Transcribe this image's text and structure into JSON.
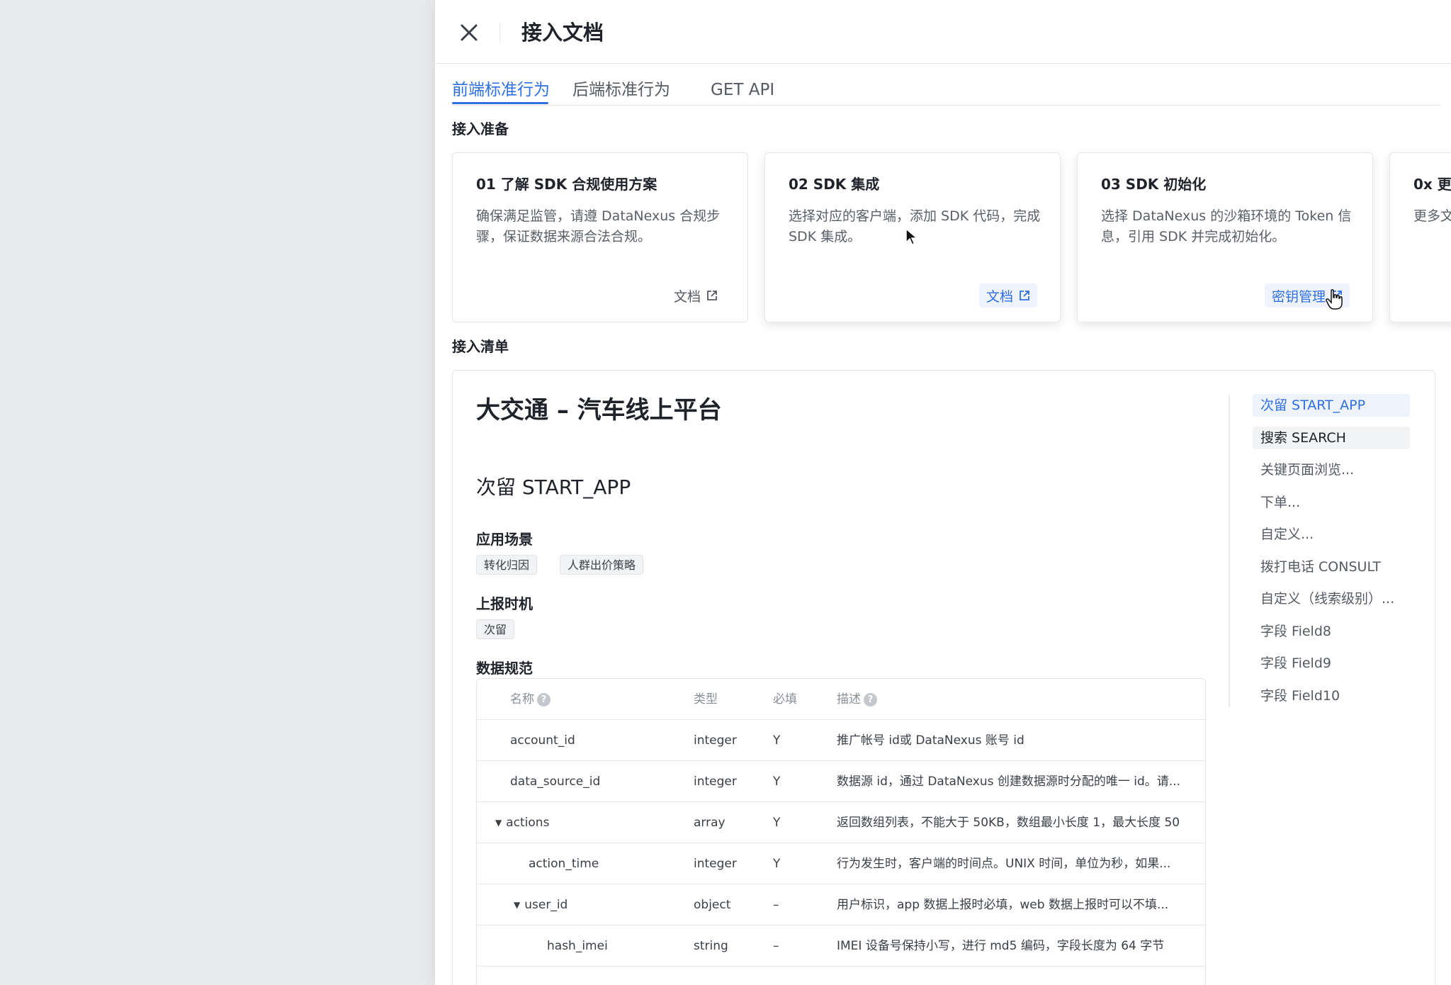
{
  "header": {
    "title": "接入文档",
    "close_icon": "close-icon"
  },
  "tabs": [
    {
      "label": "前端标准行为",
      "active": true
    },
    {
      "label": "后端标准行为",
      "active": false
    },
    {
      "label": "GET API",
      "active": false
    }
  ],
  "prep": {
    "title": "接入准备",
    "cards": [
      {
        "title": "01 了解 SDK 合规使用方案",
        "desc": "确保满足监管，请遵 DataNexus 合规步骤，保证数据来源合法合规。",
        "action": "文档"
      },
      {
        "title": "02 SDK 集成",
        "desc": "选择对应的客户端，添加 SDK 代码，完成 SDK 集成。",
        "action": "文档"
      },
      {
        "title": "03 SDK 初始化",
        "desc": "选择 DataNexus 的沙箱环境的 Token 信息，引用 SDK 并完成初始化。",
        "action": "密钥管理"
      },
      {
        "title": "0x 更",
        "desc": "更多文",
        "action": ""
      }
    ]
  },
  "list": {
    "title": "接入清单",
    "doc_title": "大交通 – 汽车线上平台",
    "event_title": "次留 START_APP",
    "scene_label": "应用场景",
    "scene_tags": [
      "转化归因",
      "人群出价策略"
    ],
    "timing_label": "上报时机",
    "timing_tags": [
      "次留"
    ],
    "spec_label": "数据规范",
    "table": {
      "headers": {
        "name": "名称",
        "type": "类型",
        "required": "必填",
        "desc": "描述"
      },
      "rows": [
        {
          "name": "account_id",
          "type": "integer",
          "required": "Y",
          "desc": "推广帐号 id或 DataNexus 账号 id"
        },
        {
          "name": "data_source_id",
          "type": "integer",
          "required": "Y",
          "desc": "数据源 id，通过 DataNexus 创建数据源时分配的唯一 id。请..."
        },
        {
          "name": "actions",
          "type": "array",
          "required": "Y",
          "desc": "返回数组列表，不能大于 50KB，数组最小长度 1，最大长度 50"
        },
        {
          "name": "action_time",
          "type": "integer",
          "required": "Y",
          "desc": "行为发生时，客户端的时间点。UNIX 时间，单位为秒，如果..."
        },
        {
          "name": "user_id",
          "type": "object",
          "required": "–",
          "desc": "用户标识，app 数据上报时必填，web 数据上报时可以不填..."
        },
        {
          "name": "hash_imei",
          "type": "string",
          "required": "–",
          "desc": "IMEI 设备号保持小写，进行 md5 编码，字段长度为 64 字节"
        },
        {
          "name": "",
          "type": "",
          "required": "",
          "desc": ""
        }
      ]
    },
    "anchors": [
      "次留 START_APP",
      "搜索 SEARCH",
      "关键页面浏览...",
      "下单...",
      "自定义...",
      "拨打电话 CONSULT",
      "自定义（线索级别）...",
      "字段 Field8",
      "字段 Field9",
      "字段 Field10"
    ]
  },
  "colors": {
    "accent": "#2f6fe4",
    "accent_bg": "#eef3fd",
    "backdrop": "#e8e9eb"
  }
}
